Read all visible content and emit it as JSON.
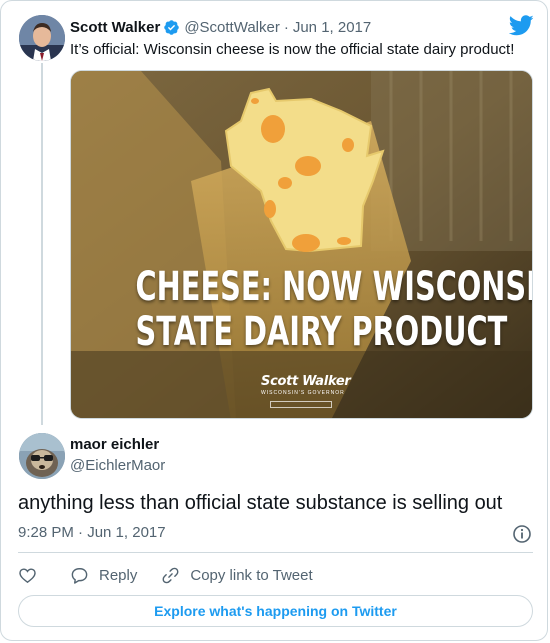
{
  "quoted_tweet": {
    "author_name": "Scott Walker",
    "verified": true,
    "handle": "@ScottWalker",
    "separator": "·",
    "date": "Jun 1, 2017",
    "text": "It’s official: Wisconsin cheese is now the official state dairy product!",
    "media": {
      "headline_line1": "CHEESE: NOW WISCONSIN’S",
      "headline_line2": "STATE DAIRY PRODUCT",
      "brand_name": "Scott Walker",
      "brand_subtitle": "WISCONSIN'S GOVERNOR"
    }
  },
  "reply": {
    "author_name": "maor eichler",
    "handle": "@EichlerMaor",
    "text": "anything less than official state substance is selling out",
    "timestamp": "9:28 PM · Jun 1, 2017"
  },
  "actions": {
    "reply_label": "Reply",
    "copy_link_label": "Copy link to Tweet"
  },
  "explore_label": "Explore what's happening on Twitter",
  "icons": {
    "verified": "verified-badge-icon",
    "brand": "twitter-bird-icon",
    "info": "info-icon",
    "like": "heart-icon",
    "reply": "speech-bubble-icon",
    "copy_link": "link-icon"
  },
  "colors": {
    "accent": "#1d9bf0",
    "text_primary": "#0f1419",
    "text_secondary": "#536471",
    "border": "#cfd9de"
  }
}
